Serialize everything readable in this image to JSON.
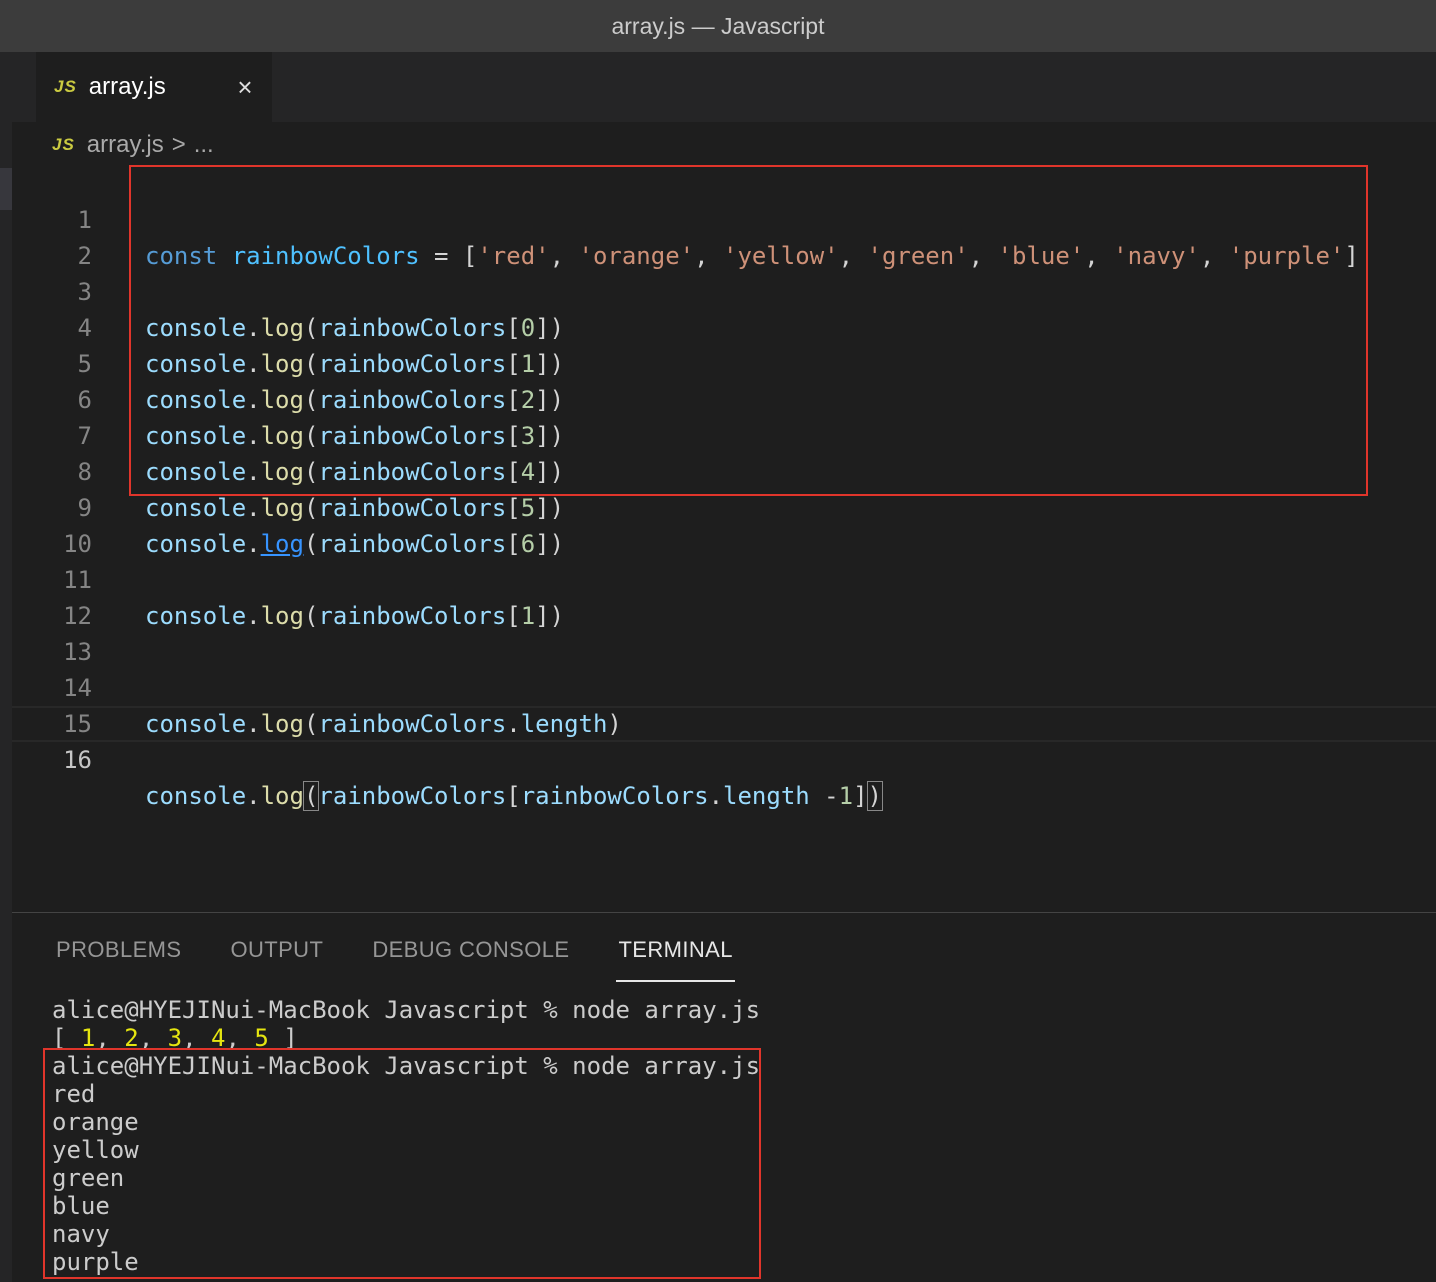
{
  "window": {
    "title": "array.js — Javascript"
  },
  "tab": {
    "badge": "JS",
    "label": "array.js",
    "close_glyph": "×",
    "close_icon": "close-icon"
  },
  "breadcrumb": {
    "badge": "JS",
    "file": "array.js",
    "separator": ">",
    "more": "..."
  },
  "editor": {
    "line_numbers": [
      "1",
      "2",
      "3",
      "4",
      "5",
      "6",
      "7",
      "8",
      "9",
      "10",
      "11",
      "12",
      "13",
      "14",
      "15",
      "16"
    ],
    "current_line": "16",
    "tokens": {
      "const": "const",
      "var": "rainbowColors",
      "console": "console",
      "log": "log",
      "length": "length",
      "colors": [
        "'red'",
        "'orange'",
        "'yellow'",
        "'green'",
        "'blue'",
        "'navy'",
        "'purple'"
      ],
      "indices": [
        "0",
        "1",
        "2",
        "3",
        "4",
        "5",
        "6"
      ],
      "one": "1"
    }
  },
  "panel": {
    "tabs": [
      "PROBLEMS",
      "OUTPUT",
      "DEBUG CONSOLE",
      "TERMINAL"
    ],
    "active_tab": "TERMINAL"
  },
  "terminal": {
    "prompt1": "alice@HYEJINui-MacBook Javascript % node array.js",
    "array_output": {
      "open": "[ ",
      "values": [
        "1",
        "2",
        "3",
        "4",
        "5"
      ],
      "close": " ]"
    },
    "prompt2": "alice@HYEJINui-MacBook Javascript % node array.js",
    "outputs": [
      "red",
      "orange",
      "yellow",
      "green",
      "blue",
      "navy",
      "purple"
    ]
  },
  "colors": {
    "highlight_box": "#e0352b",
    "background": "#1e1e1e",
    "title_bar": "#3c3c3c"
  }
}
